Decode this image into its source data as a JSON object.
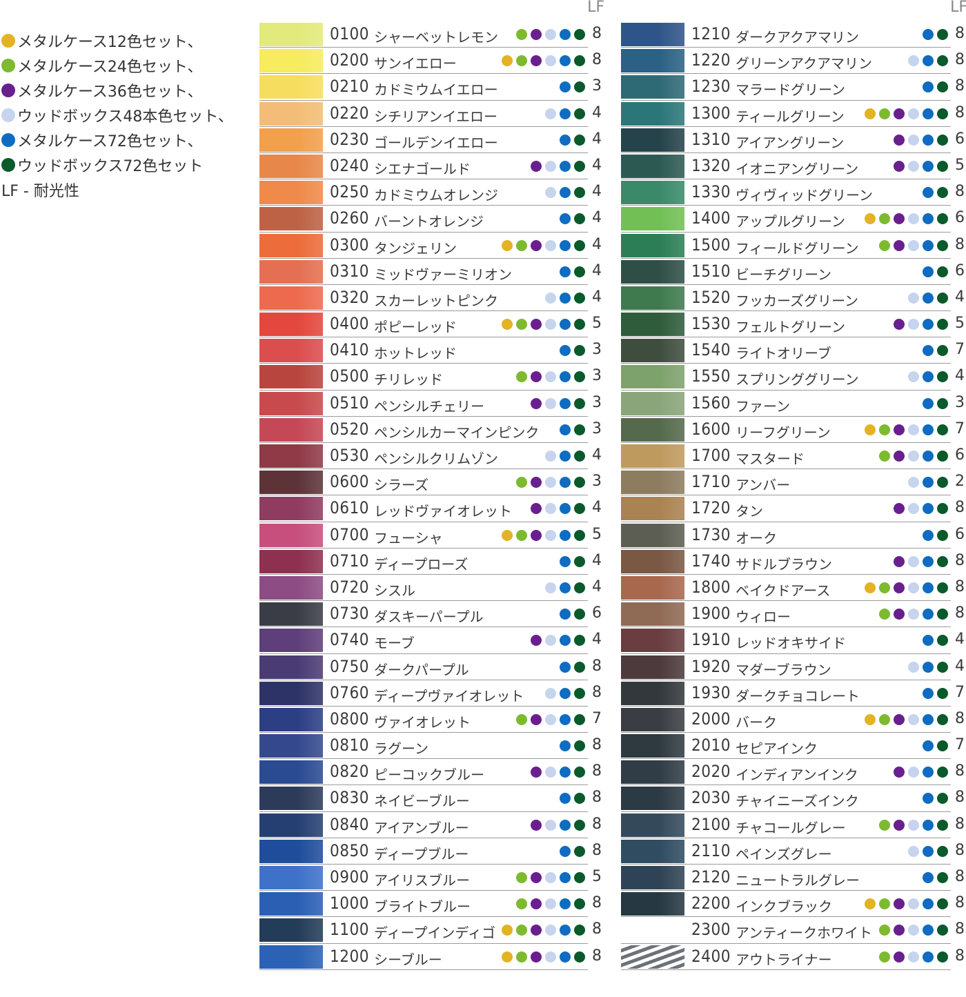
{
  "legend": {
    "items": [
      {
        "label": "メタルケース12色セット、",
        "color": "#e3b324"
      },
      {
        "label": "メタルケース24色セット、",
        "color": "#7dba2f"
      },
      {
        "label": "メタルケース36色セット、",
        "color": "#6a1f8e"
      },
      {
        "label": "ウッドボックス48本色セット、",
        "color": "#c6d4ee"
      },
      {
        "label": "メタルケース72色セット、",
        "color": "#0f6cc0"
      },
      {
        "label": "ウッドボックス72色セット",
        "color": "#0a5a2c"
      }
    ],
    "lf_note": "LF - 耐光性"
  },
  "columns": {
    "lf_header": "LF",
    "left": [
      {
        "code": "0100",
        "name": "シャーベットレモン",
        "sets": [
          "green",
          "purple",
          "light",
          "blue",
          "dark"
        ],
        "lf": "8",
        "color": "#e2ea7c"
      },
      {
        "code": "0200",
        "name": "サンイエロー",
        "sets": [
          "yellow",
          "green",
          "purple",
          "light",
          "blue",
          "dark"
        ],
        "lf": "8",
        "color": "#f6ec5e"
      },
      {
        "code": "0210",
        "name": "カドミウムイエロー",
        "sets": [
          "blue",
          "dark"
        ],
        "lf": "3",
        "color": "#f7dd5f"
      },
      {
        "code": "0220",
        "name": "シチリアンイエロー",
        "sets": [
          "light",
          "blue",
          "dark"
        ],
        "lf": "4",
        "color": "#f3bd77"
      },
      {
        "code": "0230",
        "name": "ゴールデンイエロー",
        "sets": [
          "blue",
          "dark"
        ],
        "lf": "4",
        "color": "#f1a04c"
      },
      {
        "code": "0240",
        "name": "シエナゴールド",
        "sets": [
          "purple",
          "light",
          "blue",
          "dark"
        ],
        "lf": "4",
        "color": "#e7884a"
      },
      {
        "code": "0250",
        "name": "カドミウムオレンジ",
        "sets": [
          "light",
          "blue",
          "dark"
        ],
        "lf": "4",
        "color": "#ef8a4a"
      },
      {
        "code": "0260",
        "name": "バーントオレンジ",
        "sets": [
          "blue",
          "dark"
        ],
        "lf": "4",
        "color": "#bd6245"
      },
      {
        "code": "0300",
        "name": "タンジェリン",
        "sets": [
          "yellow",
          "green",
          "purple",
          "light",
          "blue",
          "dark"
        ],
        "lf": "4",
        "color": "#ec6c3b"
      },
      {
        "code": "0310",
        "name": "ミッドヴァーミリオン",
        "sets": [
          "blue",
          "dark"
        ],
        "lf": "4",
        "color": "#e46f52"
      },
      {
        "code": "0320",
        "name": "スカーレットピンク",
        "sets": [
          "light",
          "blue",
          "dark"
        ],
        "lf": "4",
        "color": "#ee6a4f"
      },
      {
        "code": "0400",
        "name": "ポピーレッド",
        "sets": [
          "yellow",
          "green",
          "purple",
          "light",
          "blue",
          "dark"
        ],
        "lf": "5",
        "color": "#e3473d"
      },
      {
        "code": "0410",
        "name": "ホットレッド",
        "sets": [
          "blue",
          "dark"
        ],
        "lf": "3",
        "color": "#dc4d4e"
      },
      {
        "code": "0500",
        "name": "チリレッド",
        "sets": [
          "green",
          "purple",
          "light",
          "blue",
          "dark"
        ],
        "lf": "3",
        "color": "#b8453e"
      },
      {
        "code": "0510",
        "name": "ペンシルチェリー",
        "sets": [
          "purple",
          "light",
          "blue",
          "dark"
        ],
        "lf": "3",
        "color": "#c84a4c"
      },
      {
        "code": "0520",
        "name": "ペンシルカーマインピンク",
        "sets": [
          "blue",
          "dark"
        ],
        "lf": "3",
        "color": "#c54856"
      },
      {
        "code": "0530",
        "name": "ペンシルクリムゾン",
        "sets": [
          "light",
          "blue",
          "dark"
        ],
        "lf": "4",
        "color": "#8f3a46"
      },
      {
        "code": "0600",
        "name": "シラーズ",
        "sets": [
          "green",
          "purple",
          "light",
          "blue",
          "dark"
        ],
        "lf": "3",
        "color": "#5d3338"
      },
      {
        "code": "0610",
        "name": "レッドヴァイオレット",
        "sets": [
          "purple",
          "light",
          "blue",
          "dark"
        ],
        "lf": "4",
        "color": "#8f3c61"
      },
      {
        "code": "0700",
        "name": "フューシャ",
        "sets": [
          "yellow",
          "green",
          "purple",
          "light",
          "blue",
          "dark"
        ],
        "lf": "5",
        "color": "#c64f7d"
      },
      {
        "code": "0710",
        "name": "ディープローズ",
        "sets": [
          "blue",
          "dark"
        ],
        "lf": "4",
        "color": "#8e3050"
      },
      {
        "code": "0720",
        "name": "シスル",
        "sets": [
          "light",
          "blue",
          "dark"
        ],
        "lf": "4",
        "color": "#8d4c83"
      },
      {
        "code": "0730",
        "name": "ダスキーパープル",
        "sets": [
          "blue",
          "dark"
        ],
        "lf": "6",
        "color": "#3a3d46"
      },
      {
        "code": "0740",
        "name": "モーブ",
        "sets": [
          "purple",
          "light",
          "blue",
          "dark"
        ],
        "lf": "4",
        "color": "#5e3f7b"
      },
      {
        "code": "0750",
        "name": "ダークパープル",
        "sets": [
          "blue",
          "dark"
        ],
        "lf": "8",
        "color": "#4b3b74"
      },
      {
        "code": "0760",
        "name": "ディープヴァイオレット",
        "sets": [
          "light",
          "blue",
          "dark"
        ],
        "lf": "8",
        "color": "#2e3367"
      },
      {
        "code": "0800",
        "name": "ヴァイオレット",
        "sets": [
          "green",
          "purple",
          "light",
          "blue",
          "dark"
        ],
        "lf": "7",
        "color": "#2c3f84"
      },
      {
        "code": "0810",
        "name": "ラグーン",
        "sets": [
          "blue",
          "dark"
        ],
        "lf": "8",
        "color": "#34498d"
      },
      {
        "code": "0820",
        "name": "ピーコックブルー",
        "sets": [
          "purple",
          "light",
          "blue",
          "dark"
        ],
        "lf": "8",
        "color": "#2a4a92"
      },
      {
        "code": "0830",
        "name": "ネイビーブルー",
        "sets": [
          "blue",
          "dark"
        ],
        "lf": "8",
        "color": "#2d3b5a"
      },
      {
        "code": "0840",
        "name": "アイアンブルー",
        "sets": [
          "purple",
          "light",
          "blue",
          "dark"
        ],
        "lf": "8",
        "color": "#263f72"
      },
      {
        "code": "0850",
        "name": "ディープブルー",
        "sets": [
          "blue",
          "dark"
        ],
        "lf": "8",
        "color": "#1f4d9b"
      },
      {
        "code": "0900",
        "name": "アイリスブルー",
        "sets": [
          "green",
          "purple",
          "light",
          "blue",
          "dark"
        ],
        "lf": "5",
        "color": "#3e72c8"
      },
      {
        "code": "1000",
        "name": "ブライトブルー",
        "sets": [
          "green",
          "purple",
          "light",
          "blue",
          "dark"
        ],
        "lf": "8",
        "color": "#2b5fb4"
      },
      {
        "code": "1100",
        "name": "ディープインディゴ",
        "sets": [
          "yellow",
          "green",
          "purple",
          "light",
          "blue",
          "dark"
        ],
        "lf": "8",
        "color": "#233c57"
      },
      {
        "code": "1200",
        "name": "シーブルー",
        "sets": [
          "yellow",
          "green",
          "purple",
          "light",
          "blue",
          "dark"
        ],
        "lf": "8",
        "color": "#2b62b5"
      }
    ],
    "right": [
      {
        "code": "1210",
        "name": "ダークアクアマリン",
        "sets": [
          "blue",
          "dark"
        ],
        "lf": "8",
        "color": "#2f5588"
      },
      {
        "code": "1220",
        "name": "グリーンアクアマリン",
        "sets": [
          "light",
          "blue",
          "dark"
        ],
        "lf": "8",
        "color": "#2b6184"
      },
      {
        "code": "1230",
        "name": "マラードグリーン",
        "sets": [
          "blue",
          "dark"
        ],
        "lf": "8",
        "color": "#2e6a76"
      },
      {
        "code": "1300",
        "name": "ティールグリーン",
        "sets": [
          "yellow",
          "green",
          "purple",
          "light",
          "blue",
          "dark"
        ],
        "lf": "8",
        "color": "#2b7679"
      },
      {
        "code": "1310",
        "name": "アイアングリーン",
        "sets": [
          "purple",
          "light",
          "blue",
          "dark"
        ],
        "lf": "6",
        "color": "#25434a"
      },
      {
        "code": "1320",
        "name": "イオニアングリーン",
        "sets": [
          "purple",
          "light",
          "blue",
          "dark"
        ],
        "lf": "5",
        "color": "#2c5a52"
      },
      {
        "code": "1330",
        "name": "ヴィヴィッドグリーン",
        "sets": [
          "blue",
          "dark"
        ],
        "lf": "8",
        "color": "#3a8a6a"
      },
      {
        "code": "1400",
        "name": "アップルグリーン",
        "sets": [
          "yellow",
          "green",
          "purple",
          "light",
          "blue",
          "dark"
        ],
        "lf": "6",
        "color": "#72bf56"
      },
      {
        "code": "1500",
        "name": "フィールドグリーン",
        "sets": [
          "green",
          "purple",
          "light",
          "blue",
          "dark"
        ],
        "lf": "8",
        "color": "#2b7e55"
      },
      {
        "code": "1510",
        "name": "ビーチグリーン",
        "sets": [
          "blue",
          "dark"
        ],
        "lf": "6",
        "color": "#2f4f46"
      },
      {
        "code": "1520",
        "name": "フッカーズグリーン",
        "sets": [
          "light",
          "blue",
          "dark"
        ],
        "lf": "4",
        "color": "#3f7a4f"
      },
      {
        "code": "1530",
        "name": "フェルトグリーン",
        "sets": [
          "purple",
          "light",
          "blue",
          "dark"
        ],
        "lf": "5",
        "color": "#2f5c3b"
      },
      {
        "code": "1540",
        "name": "ライトオリーブ",
        "sets": [
          "blue",
          "dark"
        ],
        "lf": "7",
        "color": "#3f4d3e"
      },
      {
        "code": "1550",
        "name": "スプリンググリーン",
        "sets": [
          "light",
          "blue",
          "dark"
        ],
        "lf": "4",
        "color": "#7ea26c"
      },
      {
        "code": "1560",
        "name": "ファーン",
        "sets": [
          "blue",
          "dark"
        ],
        "lf": "3",
        "color": "#8aa57a"
      },
      {
        "code": "1600",
        "name": "リーフグリーン",
        "sets": [
          "yellow",
          "green",
          "purple",
          "light",
          "blue",
          "dark"
        ],
        "lf": "7",
        "color": "#556a4d"
      },
      {
        "code": "1700",
        "name": "マスタード",
        "sets": [
          "green",
          "purple",
          "light",
          "blue",
          "dark"
        ],
        "lf": "6",
        "color": "#bf9a5e"
      },
      {
        "code": "1710",
        "name": "アンバー",
        "sets": [
          "light",
          "blue",
          "dark"
        ],
        "lf": "2",
        "color": "#8d7c5f"
      },
      {
        "code": "1720",
        "name": "タン",
        "sets": [
          "purple",
          "light",
          "blue",
          "dark"
        ],
        "lf": "8",
        "color": "#a98351"
      },
      {
        "code": "1730",
        "name": "オーク",
        "sets": [
          "blue",
          "dark"
        ],
        "lf": "6",
        "color": "#5c5e53"
      },
      {
        "code": "1740",
        "name": "サドルブラウン",
        "sets": [
          "purple",
          "light",
          "blue",
          "dark"
        ],
        "lf": "8",
        "color": "#7a5844"
      },
      {
        "code": "1800",
        "name": "ベイクドアース",
        "sets": [
          "yellow",
          "green",
          "purple",
          "light",
          "blue",
          "dark"
        ],
        "lf": "8",
        "color": "#a8684e"
      },
      {
        "code": "1900",
        "name": "ウィロー",
        "sets": [
          "green",
          "purple",
          "light",
          "blue",
          "dark"
        ],
        "lf": "8",
        "color": "#8f6b55"
      },
      {
        "code": "1910",
        "name": "レッドオキサイド",
        "sets": [
          "blue",
          "dark"
        ],
        "lf": "4",
        "color": "#6a3e40"
      },
      {
        "code": "1920",
        "name": "マダーブラウン",
        "sets": [
          "light",
          "blue",
          "dark"
        ],
        "lf": "4",
        "color": "#4c3a3c"
      },
      {
        "code": "1930",
        "name": "ダークチョコレート",
        "sets": [
          "blue",
          "dark"
        ],
        "lf": "7",
        "color": "#33383c"
      },
      {
        "code": "2000",
        "name": "バーク",
        "sets": [
          "yellow",
          "green",
          "purple",
          "light",
          "blue",
          "dark"
        ],
        "lf": "8",
        "color": "#3a3e44"
      },
      {
        "code": "2010",
        "name": "セピアインク",
        "sets": [
          "blue",
          "dark"
        ],
        "lf": "7",
        "color": "#2f3a40"
      },
      {
        "code": "2020",
        "name": "インディアンインク",
        "sets": [
          "purple",
          "light",
          "blue",
          "dark"
        ],
        "lf": "8",
        "color": "#303c46"
      },
      {
        "code": "2030",
        "name": "チャイニーズインク",
        "sets": [
          "blue",
          "dark"
        ],
        "lf": "8",
        "color": "#2c3a44"
      },
      {
        "code": "2100",
        "name": "チャコールグレー",
        "sets": [
          "green",
          "purple",
          "light",
          "blue",
          "dark"
        ],
        "lf": "8",
        "color": "#344a5b"
      },
      {
        "code": "2110",
        "name": "ペインズグレー",
        "sets": [
          "light",
          "blue",
          "dark"
        ],
        "lf": "8",
        "color": "#2f4c61"
      },
      {
        "code": "2120",
        "name": "ニュートラルグレー",
        "sets": [
          "blue",
          "dark"
        ],
        "lf": "8",
        "color": "#2e4355"
      },
      {
        "code": "2200",
        "name": "インクブラック",
        "sets": [
          "yellow",
          "green",
          "purple",
          "light",
          "blue",
          "dark"
        ],
        "lf": "8",
        "color": "#263842"
      },
      {
        "code": "2300",
        "name": "アンティークホワイト",
        "sets": [
          "green",
          "purple",
          "light",
          "blue",
          "dark"
        ],
        "lf": "8",
        "color": "#ffffff"
      },
      {
        "code": "2400",
        "name": "アウトライナー",
        "sets": [
          "green",
          "purple",
          "light",
          "blue",
          "dark"
        ],
        "lf": "8",
        "color": "#6c7278"
      }
    ]
  }
}
